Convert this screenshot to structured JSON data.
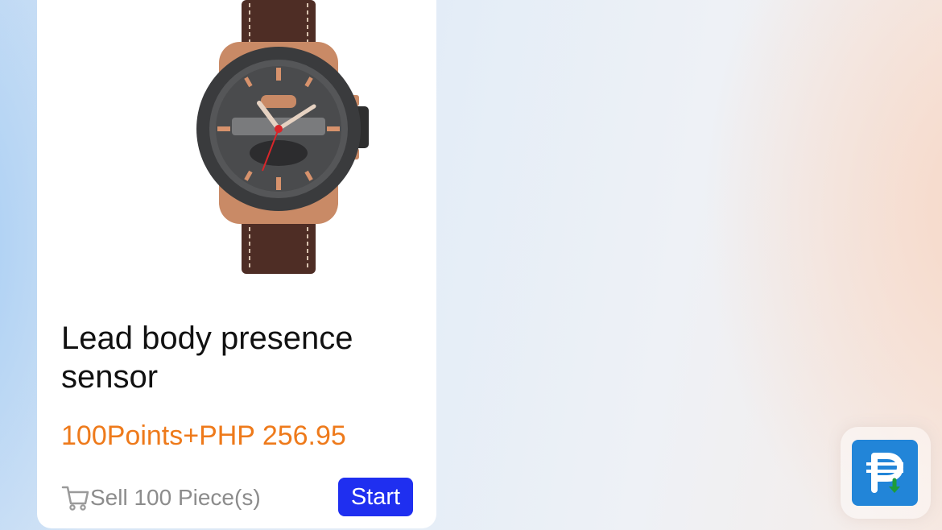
{
  "product": {
    "image_alt": "Brown leather strap watch",
    "title": "Lead body presence sensor",
    "price": "100Points+PHP 256.95",
    "sales": "Sell 100 Piece(s)",
    "start_label": "Start"
  },
  "floating_button": {
    "icon": "peso-withdraw-icon"
  },
  "colors": {
    "price": "#ee7a1b",
    "start_button": "#1f2ff0",
    "floating_button": "#2285d8",
    "floating_arrow": "#1e9c3a"
  }
}
